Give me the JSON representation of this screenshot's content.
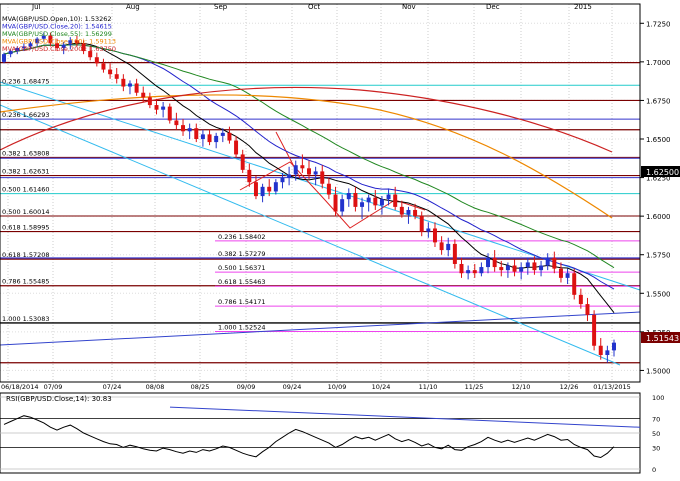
{
  "chart_data": {
    "type": "candlestick",
    "months": [
      "Jul",
      "Aug",
      "Sep",
      "Oct",
      "Nov",
      "Dec",
      "2015"
    ],
    "price_ticks": [
      "1.7250",
      "1.7000",
      "1.6750",
      "1.6500",
      "1.6250",
      "1.6000",
      "1.5750",
      "1.5500",
      "1.5250",
      "1.5000"
    ],
    "date_ticks": [
      "06/18/2014",
      "07/09",
      "07/24",
      "08/08",
      "08/25",
      "09/09",
      "09/24",
      "10/09",
      "10/24",
      "11/10",
      "11/25",
      "12/10",
      "12/26",
      "01/13/2015"
    ],
    "ylim": [
      1.4925,
      1.7375
    ],
    "legend": [
      {
        "label": "MVA(GBP/USD.Open,10): 1.53262",
        "color": "#000000"
      },
      {
        "label": "MVA(GBP/USD.Close,20): 1.54615",
        "color": "#2222cc"
      },
      {
        "label": "MVA(GBP/USD.Close,55): 1.56299",
        "color": "#228822"
      },
      {
        "label": "MVA(GBP/USD.Close,100): 1.59113",
        "color": "#ee8800"
      },
      {
        "label": "MVA(GBP/USD.Close,200): 1.63750",
        "color": "#cc2222"
      }
    ],
    "current_price": "1.51543",
    "price_marker_1": "1.62500",
    "fib_labels": [
      {
        "text": "0.236 1.68475",
        "price": 1.6848
      },
      {
        "text": "0.236 1.66293",
        "price": 1.6629
      },
      {
        "text": "0.382 1.63808",
        "price": 1.6381
      },
      {
        "text": "0.382 1.62631",
        "price": 1.6263
      },
      {
        "text": "0.500 1.61460",
        "price": 1.6146
      },
      {
        "text": "0.500 1.60014",
        "price": 1.6001
      },
      {
        "text": "0.618 1.58995",
        "price": 1.59
      },
      {
        "text": "0.618 1.57208",
        "price": 1.5721
      },
      {
        "text": "0.786 1.55485",
        "price": 1.5549
      },
      {
        "text": "0.236 1.58402",
        "price": 1.584
      },
      {
        "text": "0.382 1.57279",
        "price": 1.5728
      },
      {
        "text": "0.500 1.56371",
        "price": 1.5637
      },
      {
        "text": "0.618 1.55463",
        "price": 1.5546
      },
      {
        "text": "0.786 1.54171",
        "price": 1.5417
      },
      {
        "text": "1.000 1.52524",
        "price": 1.5252
      },
      {
        "text": "1.000 1.53083",
        "price": 1.5308
      }
    ],
    "colors": {
      "up": "#2233cc",
      "down": "#dd1111",
      "fib_magenta": "#ee44ee",
      "fib_maroon": "#7a0000",
      "fib_cyan": "#22cccc",
      "fib_blue": "#3333cc"
    },
    "ohlc": [
      [
        1.7,
        1.706,
        1.699,
        1.705
      ],
      [
        1.705,
        1.708,
        1.703,
        1.707
      ],
      [
        1.707,
        1.71,
        1.705,
        1.709
      ],
      [
        1.709,
        1.712,
        1.707,
        1.71
      ],
      [
        1.71,
        1.713,
        1.708,
        1.712
      ],
      [
        1.712,
        1.716,
        1.71,
        1.715
      ],
      [
        1.715,
        1.719,
        1.713,
        1.717
      ],
      [
        1.717,
        1.719,
        1.71,
        1.712
      ],
      [
        1.712,
        1.715,
        1.707,
        1.709
      ],
      [
        1.709,
        1.713,
        1.705,
        1.711
      ],
      [
        1.711,
        1.716,
        1.708,
        1.714
      ],
      [
        1.714,
        1.717,
        1.71,
        1.712
      ],
      [
        1.712,
        1.714,
        1.705,
        1.707
      ],
      [
        1.707,
        1.71,
        1.701,
        1.703
      ],
      [
        1.703,
        1.706,
        1.697,
        1.699
      ],
      [
        1.699,
        1.702,
        1.693,
        1.695
      ],
      [
        1.695,
        1.699,
        1.689,
        1.692
      ],
      [
        1.692,
        1.696,
        1.686,
        1.689
      ],
      [
        1.689,
        1.692,
        1.681,
        1.684
      ],
      [
        1.684,
        1.688,
        1.679,
        1.686
      ],
      [
        1.686,
        1.689,
        1.678,
        1.68
      ],
      [
        1.68,
        1.684,
        1.674,
        1.677
      ],
      [
        1.677,
        1.68,
        1.67,
        1.672
      ],
      [
        1.672,
        1.676,
        1.666,
        1.669
      ],
      [
        1.669,
        1.674,
        1.664,
        1.671
      ],
      [
        1.671,
        1.673,
        1.66,
        1.662
      ],
      [
        1.662,
        1.667,
        1.656,
        1.659
      ],
      [
        1.659,
        1.663,
        1.652,
        1.655
      ],
      [
        1.655,
        1.66,
        1.65,
        1.657
      ],
      [
        1.657,
        1.66,
        1.648,
        1.65
      ],
      [
        1.65,
        1.656,
        1.645,
        1.653
      ],
      [
        1.653,
        1.656,
        1.646,
        1.648
      ],
      [
        1.648,
        1.654,
        1.644,
        1.652
      ],
      [
        1.652,
        1.657,
        1.648,
        1.654
      ],
      [
        1.654,
        1.658,
        1.647,
        1.649
      ],
      [
        1.649,
        1.652,
        1.638,
        1.64
      ],
      [
        1.64,
        1.643,
        1.628,
        1.63
      ],
      [
        1.63,
        1.634,
        1.619,
        1.622
      ],
      [
        1.622,
        1.626,
        1.611,
        1.613
      ],
      [
        1.613,
        1.621,
        1.609,
        1.619
      ],
      [
        1.619,
        1.624,
        1.613,
        1.616
      ],
      [
        1.616,
        1.624,
        1.614,
        1.622
      ],
      [
        1.622,
        1.628,
        1.618,
        1.625
      ],
      [
        1.625,
        1.632,
        1.62,
        1.627
      ],
      [
        1.627,
        1.636,
        1.623,
        1.633
      ],
      [
        1.633,
        1.64,
        1.628,
        1.631
      ],
      [
        1.631,
        1.636,
        1.624,
        1.627
      ],
      [
        1.627,
        1.632,
        1.62,
        1.629
      ],
      [
        1.629,
        1.633,
        1.618,
        1.621
      ],
      [
        1.621,
        1.625,
        1.611,
        1.614
      ],
      [
        1.614,
        1.619,
        1.6,
        1.603
      ],
      [
        1.603,
        1.614,
        1.6,
        1.611
      ],
      [
        1.611,
        1.618,
        1.606,
        1.615
      ],
      [
        1.615,
        1.619,
        1.603,
        1.606
      ],
      [
        1.606,
        1.612,
        1.598,
        1.609
      ],
      [
        1.609,
        1.614,
        1.603,
        1.612
      ],
      [
        1.612,
        1.617,
        1.604,
        1.607
      ],
      [
        1.607,
        1.613,
        1.601,
        1.611
      ],
      [
        1.611,
        1.618,
        1.607,
        1.614
      ],
      [
        1.614,
        1.619,
        1.604,
        1.606
      ],
      [
        1.606,
        1.61,
        1.599,
        1.601
      ],
      [
        1.601,
        1.606,
        1.595,
        1.604
      ],
      [
        1.604,
        1.608,
        1.598,
        1.6
      ],
      [
        1.6,
        1.603,
        1.587,
        1.59
      ],
      [
        1.59,
        1.596,
        1.586,
        1.592
      ],
      [
        1.592,
        1.596,
        1.58,
        1.583
      ],
      [
        1.583,
        1.587,
        1.575,
        1.578
      ],
      [
        1.578,
        1.586,
        1.574,
        1.582
      ],
      [
        1.582,
        1.585,
        1.566,
        1.569
      ],
      [
        1.569,
        1.573,
        1.56,
        1.563
      ],
      [
        1.563,
        1.568,
        1.559,
        1.565
      ],
      [
        1.565,
        1.569,
        1.56,
        1.563
      ],
      [
        1.563,
        1.57,
        1.561,
        1.567
      ],
      [
        1.567,
        1.576,
        1.563,
        1.573
      ],
      [
        1.573,
        1.578,
        1.564,
        1.567
      ],
      [
        1.567,
        1.571,
        1.561,
        1.565
      ],
      [
        1.565,
        1.57,
        1.56,
        1.568
      ],
      [
        1.568,
        1.572,
        1.561,
        1.564
      ],
      [
        1.564,
        1.57,
        1.559,
        1.567
      ],
      [
        1.567,
        1.573,
        1.562,
        1.57
      ],
      [
        1.57,
        1.574,
        1.562,
        1.565
      ],
      [
        1.565,
        1.571,
        1.561,
        1.568
      ],
      [
        1.568,
        1.576,
        1.565,
        1.573
      ],
      [
        1.573,
        1.577,
        1.563,
        1.566
      ],
      [
        1.566,
        1.57,
        1.557,
        1.56
      ],
      [
        1.56,
        1.566,
        1.556,
        1.563
      ],
      [
        1.563,
        1.566,
        1.546,
        1.549
      ],
      [
        1.549,
        1.553,
        1.54,
        1.543
      ],
      [
        1.543,
        1.547,
        1.532,
        1.536
      ],
      [
        1.536,
        1.539,
        1.513,
        1.516
      ],
      [
        1.516,
        1.521,
        1.507,
        1.51
      ],
      [
        1.51,
        1.516,
        1.505,
        1.513
      ],
      [
        1.513,
        1.52,
        1.509,
        1.518
      ]
    ],
    "rsi": {
      "label": "RSI(GBP/USD.Close,14): 30.83",
      "ylim": [
        0,
        100
      ],
      "ticks": [
        "100",
        "70",
        "50",
        "30",
        "0"
      ],
      "values": [
        62,
        66,
        70,
        74,
        72,
        68,
        64,
        58,
        54,
        58,
        61,
        56,
        50,
        46,
        42,
        38,
        35,
        34,
        30,
        33,
        31,
        28,
        26,
        25,
        29,
        27,
        24,
        22,
        25,
        23,
        27,
        25,
        28,
        32,
        30,
        26,
        22,
        19,
        17,
        24,
        30,
        38,
        44,
        50,
        55,
        52,
        48,
        44,
        40,
        36,
        30,
        34,
        40,
        45,
        42,
        44,
        40,
        44,
        48,
        42,
        38,
        41,
        37,
        32,
        35,
        30,
        28,
        33,
        27,
        26,
        31,
        34,
        38,
        44,
        40,
        37,
        40,
        37,
        40,
        43,
        40,
        44,
        48,
        45,
        40,
        41,
        34,
        30,
        27,
        18,
        16,
        22,
        31
      ]
    }
  }
}
